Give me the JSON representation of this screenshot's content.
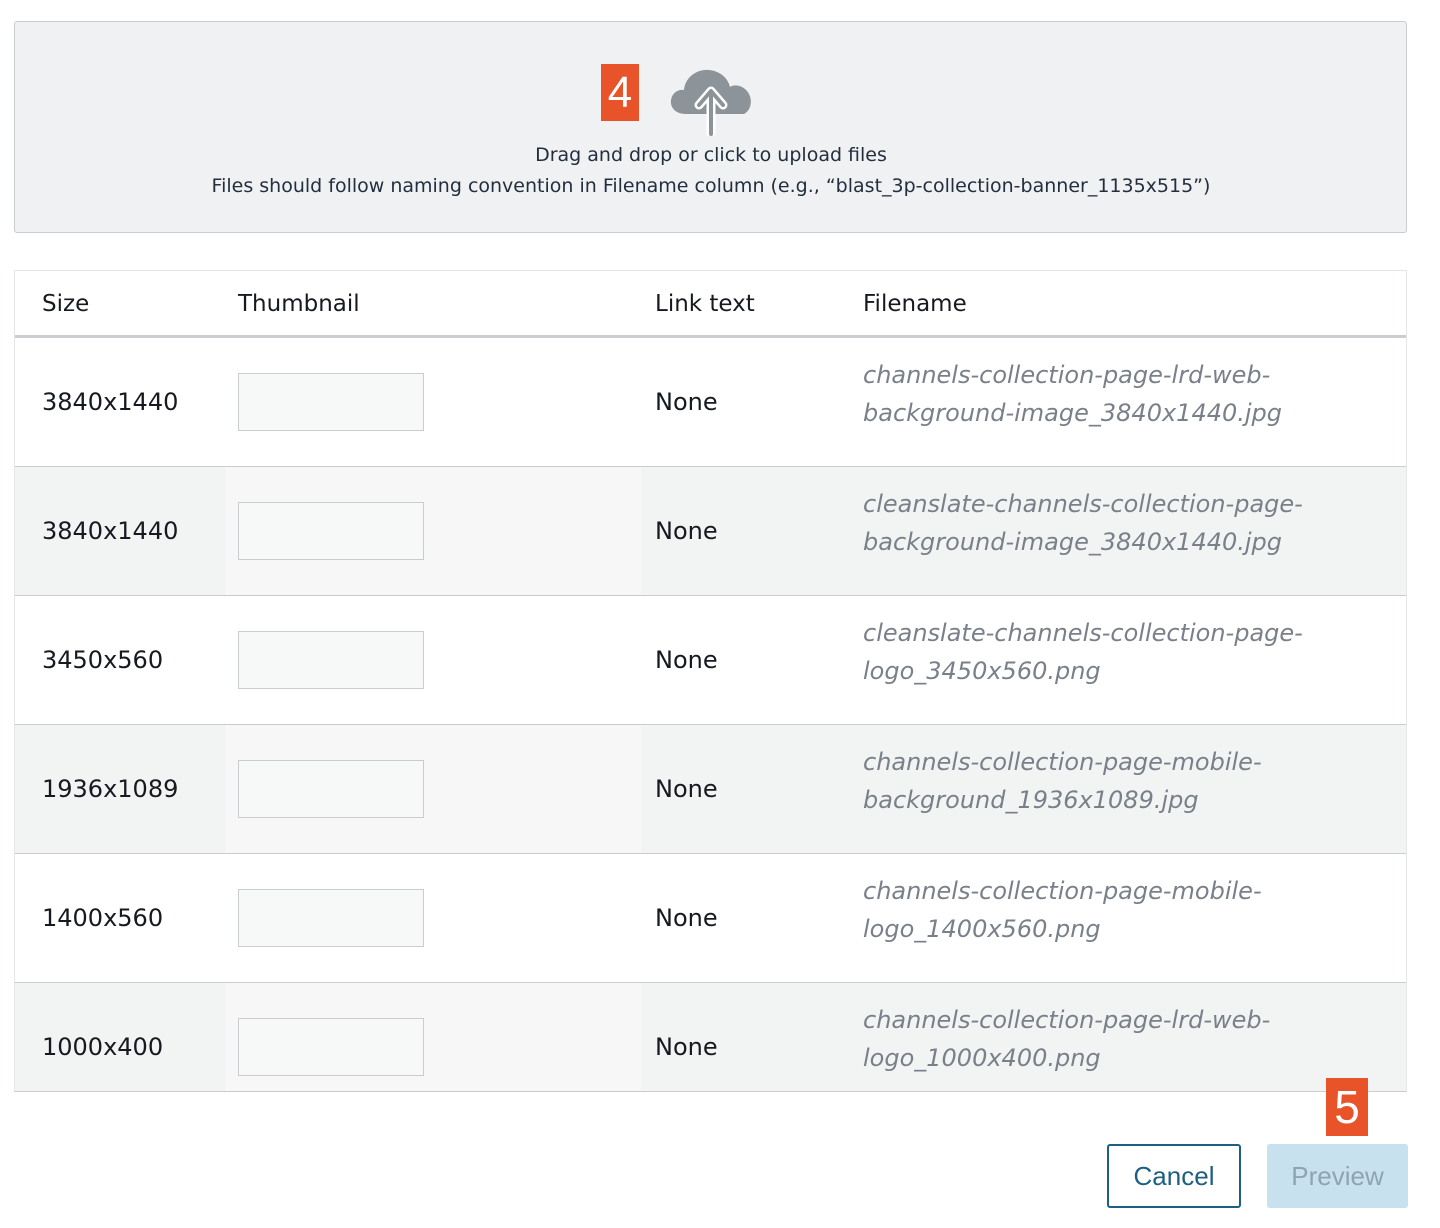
{
  "upload": {
    "step_badge": "4",
    "icon": "cloud-upload-icon",
    "instruction": "Drag and drop or click to upload files",
    "naming_hint": "Files should follow naming convention in Filename column (e.g., “blast_3p-collection-banner_1135x515”)"
  },
  "table": {
    "headers": [
      "Size",
      "Thumbnail",
      "Link text",
      "Filename"
    ],
    "rows": [
      {
        "size": "3840x1440",
        "link_text": "None",
        "filename_line1": "channels-collection-page-lrd-web-",
        "filename_line2": "background-image_3840x1440.jpg"
      },
      {
        "size": "3840x1440",
        "link_text": "None",
        "filename_line1": "cleanslate-channels-collection-page-",
        "filename_line2": "background-image_3840x1440.jpg"
      },
      {
        "size": "3450x560",
        "link_text": "None",
        "filename_line1": "cleanslate-channels-collection-page-",
        "filename_line2": "logo_3450x560.png"
      },
      {
        "size": "1936x1089",
        "link_text": "None",
        "filename_line1": "channels-collection-page-mobile-",
        "filename_line2": "background_1936x1089.jpg"
      },
      {
        "size": "1400x560",
        "link_text": "None",
        "filename_line1": "channels-collection-page-mobile-",
        "filename_line2": "logo_1400x560.png"
      },
      {
        "size": "1000x400",
        "link_text": "None",
        "filename_line1": "channels-collection-page-lrd-web-",
        "filename_line2": "logo_1000x400.png"
      }
    ]
  },
  "actions": {
    "step_badge": "5",
    "cancel_label": "Cancel",
    "preview_label": "Preview"
  },
  "colors": {
    "badge": "#e8532a",
    "cancel_border": "#1d5f83",
    "preview_disabled_bg": "#c7e1ee"
  }
}
